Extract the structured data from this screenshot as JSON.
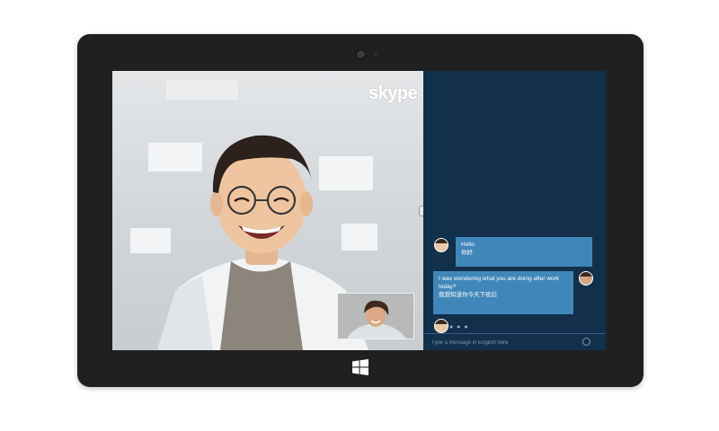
{
  "app": {
    "name": "skype"
  },
  "device": {
    "os_logo": "windows-logo"
  },
  "call": {
    "remote_video": "video-call-feed",
    "self_view": "self-preview"
  },
  "chat": {
    "messages": [
      {
        "side": "left",
        "lines": [
          "Hello",
          "你好"
        ]
      },
      {
        "side": "right",
        "lines": [
          "I was wondering what you are doing after work",
          "today?",
          "我想知道你今天下班后"
        ]
      }
    ],
    "typing_indicator": "● ● ●",
    "composer": {
      "placeholder": "Type a message in English here"
    },
    "emoji_icon": "emoji-icon"
  },
  "colors": {
    "tablet_frame": "#202021",
    "chat_bg": "#123049",
    "bubble": "#3f87bb"
  }
}
